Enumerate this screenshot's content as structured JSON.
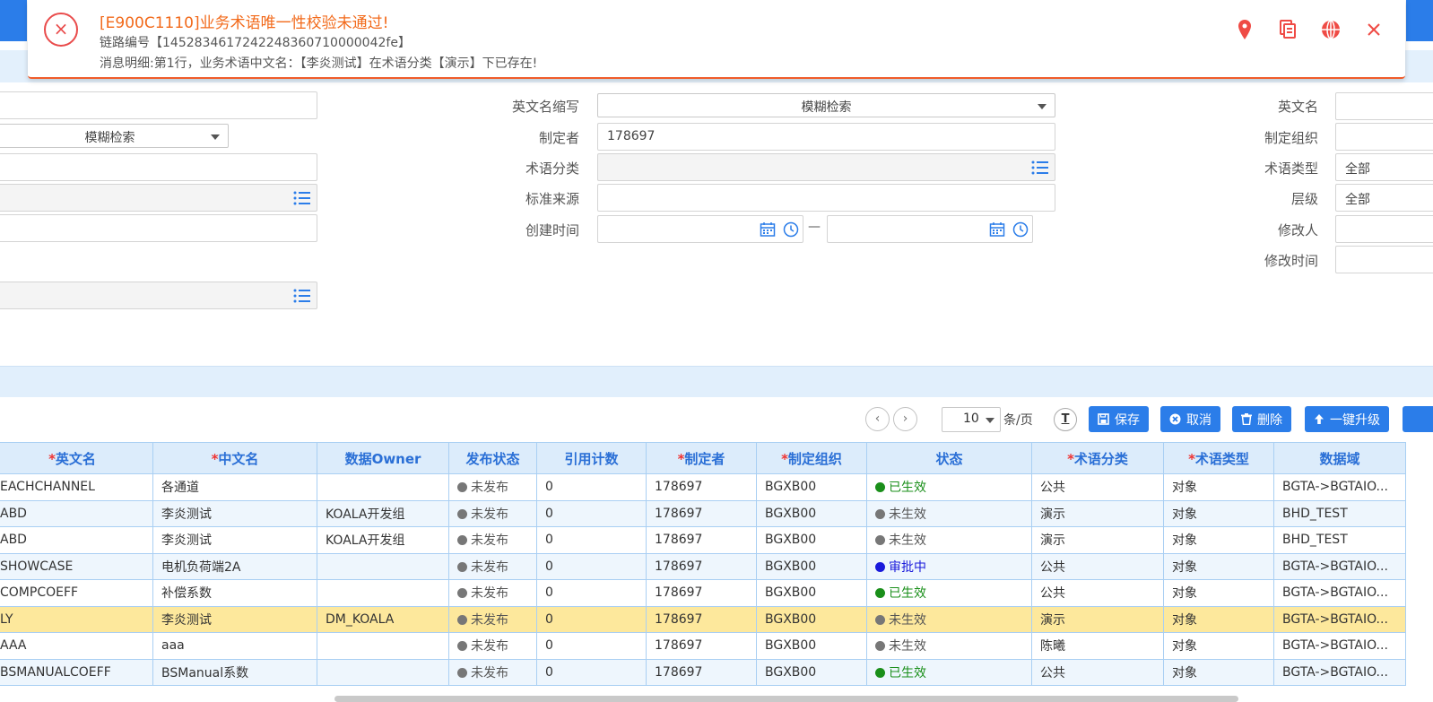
{
  "notification": {
    "title": "[E900C1110]业务术语唯一性校验未通过!",
    "trace": "链路编号【1452834617242248360710000042fe】",
    "detail": "消息明细:第1行，业务术语中文名：【李炎测试】在术语分类【演示】下已存在!",
    "close_symbol": "×",
    "action_icons": [
      "pin-icon",
      "copy-icon",
      "globe-icon",
      "close-icon"
    ],
    "accent_color": "#f26a1b"
  },
  "form": {
    "left_select_value": "模糊检索",
    "en_abbr_label": "英文名缩写",
    "en_abbr_value": "模糊检索",
    "creator_label": "制定者",
    "creator_value": "178697",
    "term_category_label": "术语分类",
    "std_source_label": "标准来源",
    "created_time_label": "创建时间",
    "created_time_sep": "—",
    "en_name_label": "英文名",
    "org_label": "制定组织",
    "term_type_label": "术语类型",
    "term_type_value": "全部",
    "level_label": "层级",
    "level_value": "全部",
    "modifier_label": "修改人",
    "modified_time_label": "修改时间"
  },
  "pager": {
    "prev": "‹",
    "next": "›",
    "page_size": "10",
    "per_page_label": "条/页",
    "text_tool": "T"
  },
  "buttons": {
    "save": "保存",
    "cancel": "取消",
    "delete": "删除",
    "upgrade": "一键升级"
  },
  "table": {
    "columns": [
      "英文名",
      "中文名",
      "数据Owner",
      "发布状态",
      "引用计数",
      "制定者",
      "制定组织",
      "状态",
      "术语分类",
      "术语类型",
      "数据域"
    ],
    "required": [
      true,
      true,
      false,
      false,
      false,
      true,
      true,
      false,
      true,
      true,
      false
    ],
    "rows": [
      {
        "en": "EACHCHANNEL",
        "cn": "各通道",
        "owner": "",
        "pub": "未发布",
        "ref": "0",
        "creator": "178697",
        "org": "BGXB00",
        "status": "已生效",
        "status_color": "green",
        "cat": "公共",
        "type": "对象",
        "domain": "BGTA->BGTAIO..."
      },
      {
        "en": "ABD",
        "cn": "李炎测试",
        "owner": "KOALA开发组",
        "pub": "未发布",
        "ref": "0",
        "creator": "178697",
        "org": "BGXB00",
        "status": "未生效",
        "status_color": "gray",
        "cat": "演示",
        "type": "对象",
        "domain": "BHD_TEST"
      },
      {
        "en": "ABD",
        "cn": "李炎测试",
        "owner": "KOALA开发组",
        "pub": "未发布",
        "ref": "0",
        "creator": "178697",
        "org": "BGXB00",
        "status": "未生效",
        "status_color": "gray",
        "cat": "演示",
        "type": "对象",
        "domain": "BHD_TEST"
      },
      {
        "en": "SHOWCASE",
        "cn": "电机负荷端2A",
        "owner": "",
        "pub": "未发布",
        "ref": "0",
        "creator": "178697",
        "org": "BGXB00",
        "status": "审批中",
        "status_color": "blue",
        "cat": "公共",
        "type": "对象",
        "domain": "BGTA->BGTAIO..."
      },
      {
        "en": "COMPCOEFF",
        "cn": "补偿系数",
        "owner": "",
        "pub": "未发布",
        "ref": "0",
        "creator": "178697",
        "org": "BGXB00",
        "status": "已生效",
        "status_color": "green",
        "cat": "公共",
        "type": "对象",
        "domain": "BGTA->BGTAIO..."
      },
      {
        "en": "LY",
        "cn": "李炎测试",
        "owner": "DM_KOALA",
        "pub": "未发布",
        "ref": "0",
        "creator": "178697",
        "org": "BGXB00",
        "status": "未生效",
        "status_color": "gray",
        "cat": "演示",
        "type": "对象",
        "domain": "BGTA->BGTAIO..."
      },
      {
        "en": "AAA",
        "cn": "aaa",
        "owner": "",
        "pub": "未发布",
        "ref": "0",
        "creator": "178697",
        "org": "BGXB00",
        "status": "未生效",
        "status_color": "gray",
        "cat": "陈曦",
        "type": "对象",
        "domain": "BGTA->BGTAIO..."
      },
      {
        "en": "BSMANUALCOEFF",
        "cn": "BSManual系数",
        "owner": "",
        "pub": "未发布",
        "ref": "0",
        "creator": "178697",
        "org": "BGXB00",
        "status": "已生效",
        "status_color": "green",
        "cat": "公共",
        "type": "对象",
        "domain": "BGTA->BGTAIO..."
      }
    ],
    "selected_row_index": 5
  },
  "colors": {
    "primary": "#2b7de9",
    "selected_row": "#fde89c",
    "status_green": "#1a8f1a",
    "status_blue": "#1a1adb",
    "status_gray": "#777777"
  }
}
